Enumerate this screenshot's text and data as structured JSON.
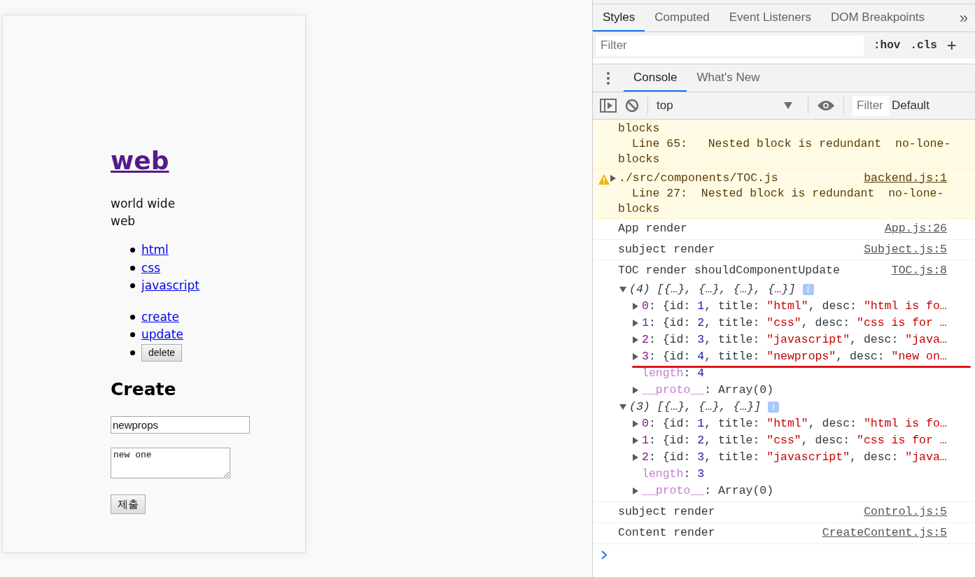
{
  "page": {
    "heading": "web",
    "description": "world wide web",
    "toc": [
      {
        "label": "html"
      },
      {
        "label": "css"
      },
      {
        "label": "javascript"
      }
    ],
    "controls": [
      {
        "kind": "link",
        "label": "create"
      },
      {
        "kind": "link",
        "label": "update"
      },
      {
        "kind": "button",
        "label": "delete"
      }
    ],
    "form": {
      "title": "Create",
      "title_value": "newprops",
      "desc_value": "new one",
      "submit": "제출"
    }
  },
  "devtools": {
    "styles_tabs": [
      {
        "label": "Styles",
        "selected": true
      },
      {
        "label": "Computed",
        "selected": false
      },
      {
        "label": "Event Listeners",
        "selected": false
      },
      {
        "label": "DOM Breakpoints",
        "selected": false
      }
    ],
    "more_tabs": "»",
    "styles_filter": {
      "placeholder": "Filter"
    },
    "hov": ":hov",
    "cls": ".cls",
    "plus": "+",
    "drawer_tabs": [
      {
        "label": "Console",
        "selected": true
      },
      {
        "label": "What's New",
        "selected": false
      }
    ],
    "console_toolbar": {
      "context": "top",
      "filter": {
        "placeholder": "Filter"
      },
      "levels": "Default"
    },
    "messages": [
      {
        "kind": "warning_tail",
        "lines": [
          "blocks",
          "  Line 65:   Nested block is redundant  no-lone-",
          "blocks"
        ]
      },
      {
        "kind": "warning",
        "expanded": false,
        "title": "./src/components/TOC.js",
        "source": "backend.js:1",
        "lines": [
          "  Line 27:  Nested block is redundant  no-lone-",
          "blocks"
        ]
      },
      {
        "kind": "log",
        "text": "App render",
        "source": "App.js:26"
      },
      {
        "kind": "log",
        "text": "subject render",
        "source": "Subject.js:5"
      },
      {
        "kind": "log",
        "text": "TOC render shouldComponentUpdate",
        "source": "TOC.js:8",
        "arrays": [
          {
            "expanded": true,
            "summary": "(4) [{…}, {…}, {…}, {…}]",
            "info": "i",
            "rows": [
              {
                "expanded": false,
                "underlined": false,
                "tokens": [
                  [
                    "0",
                    ": {id: ",
                    "1",
                    ", title: ",
                    "\"html\"",
                    ", desc: ",
                    "\"html is fo…"
                  ]
                ]
              },
              {
                "expanded": false,
                "underlined": false,
                "tokens": [
                  [
                    "1",
                    ": {id: ",
                    "2",
                    ", title: ",
                    "\"css\"",
                    ", desc: ",
                    "\"css is for …"
                  ]
                ]
              },
              {
                "expanded": false,
                "underlined": false,
                "tokens": [
                  [
                    "2",
                    ": {id: ",
                    "3",
                    ", title: ",
                    "\"javascript\"",
                    ", desc: ",
                    "\"java…"
                  ]
                ]
              },
              {
                "expanded": false,
                "underlined": true,
                "tokens": [
                  [
                    "3",
                    ": {id: ",
                    "4",
                    ", title: ",
                    "\"newprops\"",
                    ", desc: ",
                    "\"new on…"
                  ]
                ]
              }
            ],
            "length": {
              "key": "length",
              "sep": ": ",
              "value": "4"
            },
            "proto": {
              "key": "__proto__",
              "sep": ": ",
              "value": "Array(0)"
            }
          },
          {
            "expanded": true,
            "summary": "(3) [{…}, {…}, {…}]",
            "info": "i",
            "rows": [
              {
                "expanded": false,
                "underlined": false,
                "tokens": [
                  [
                    "0",
                    ": {id: ",
                    "1",
                    ", title: ",
                    "\"html\"",
                    ", desc: ",
                    "\"html is fo…"
                  ]
                ]
              },
              {
                "expanded": false,
                "underlined": false,
                "tokens": [
                  [
                    "1",
                    ": {id: ",
                    "2",
                    ", title: ",
                    "\"css\"",
                    ", desc: ",
                    "\"css is for …"
                  ]
                ]
              },
              {
                "expanded": false,
                "underlined": false,
                "tokens": [
                  [
                    "2",
                    ": {id: ",
                    "3",
                    ", title: ",
                    "\"javascript\"",
                    ", desc: ",
                    "\"java…"
                  ]
                ]
              }
            ],
            "length": {
              "key": "length",
              "sep": ": ",
              "value": "3"
            },
            "proto": {
              "key": "__proto__",
              "sep": ": ",
              "value": "Array(0)"
            }
          }
        ]
      },
      {
        "kind": "log",
        "text": "subject render",
        "source": "Control.js:5"
      },
      {
        "kind": "log",
        "text": "Content render",
        "source": "CreateContent.js:5"
      }
    ]
  }
}
